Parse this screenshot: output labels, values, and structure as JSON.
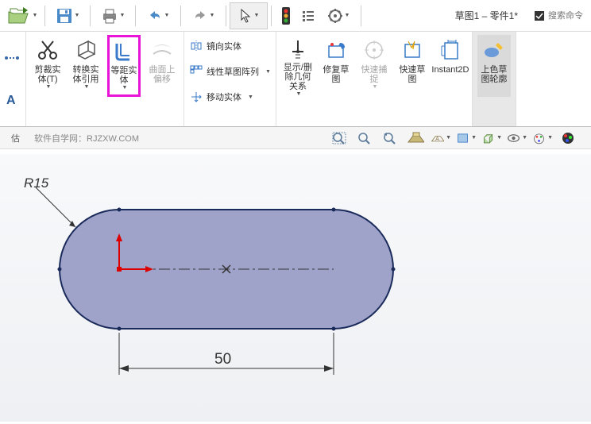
{
  "doc_title": "草图1 – 零件1*",
  "search_placeholder": "搜索命令",
  "ribbon": {
    "trim_label": "剪裁实体(T)",
    "convert_label": "转换实体引用",
    "offset_label": "等距实体",
    "surface_offset_label": "曲面上偏移",
    "mirror_label": "镜向实体",
    "pattern_label": "线性草图阵列",
    "move_label": "移动实体",
    "relations_label": "显示/删除几何关系",
    "repair_label": "修复草图",
    "quick_snap_label": "快速捕捉",
    "rapid_label": "快速草图",
    "instant_label": "Instant2D",
    "shade_label": "上色草图轮廓"
  },
  "sub_bar": {
    "eval_label": "估",
    "site_label": "软件自学网：RJZXW.COM"
  },
  "sketch": {
    "dim_width": "50",
    "dim_radius": "R15"
  }
}
